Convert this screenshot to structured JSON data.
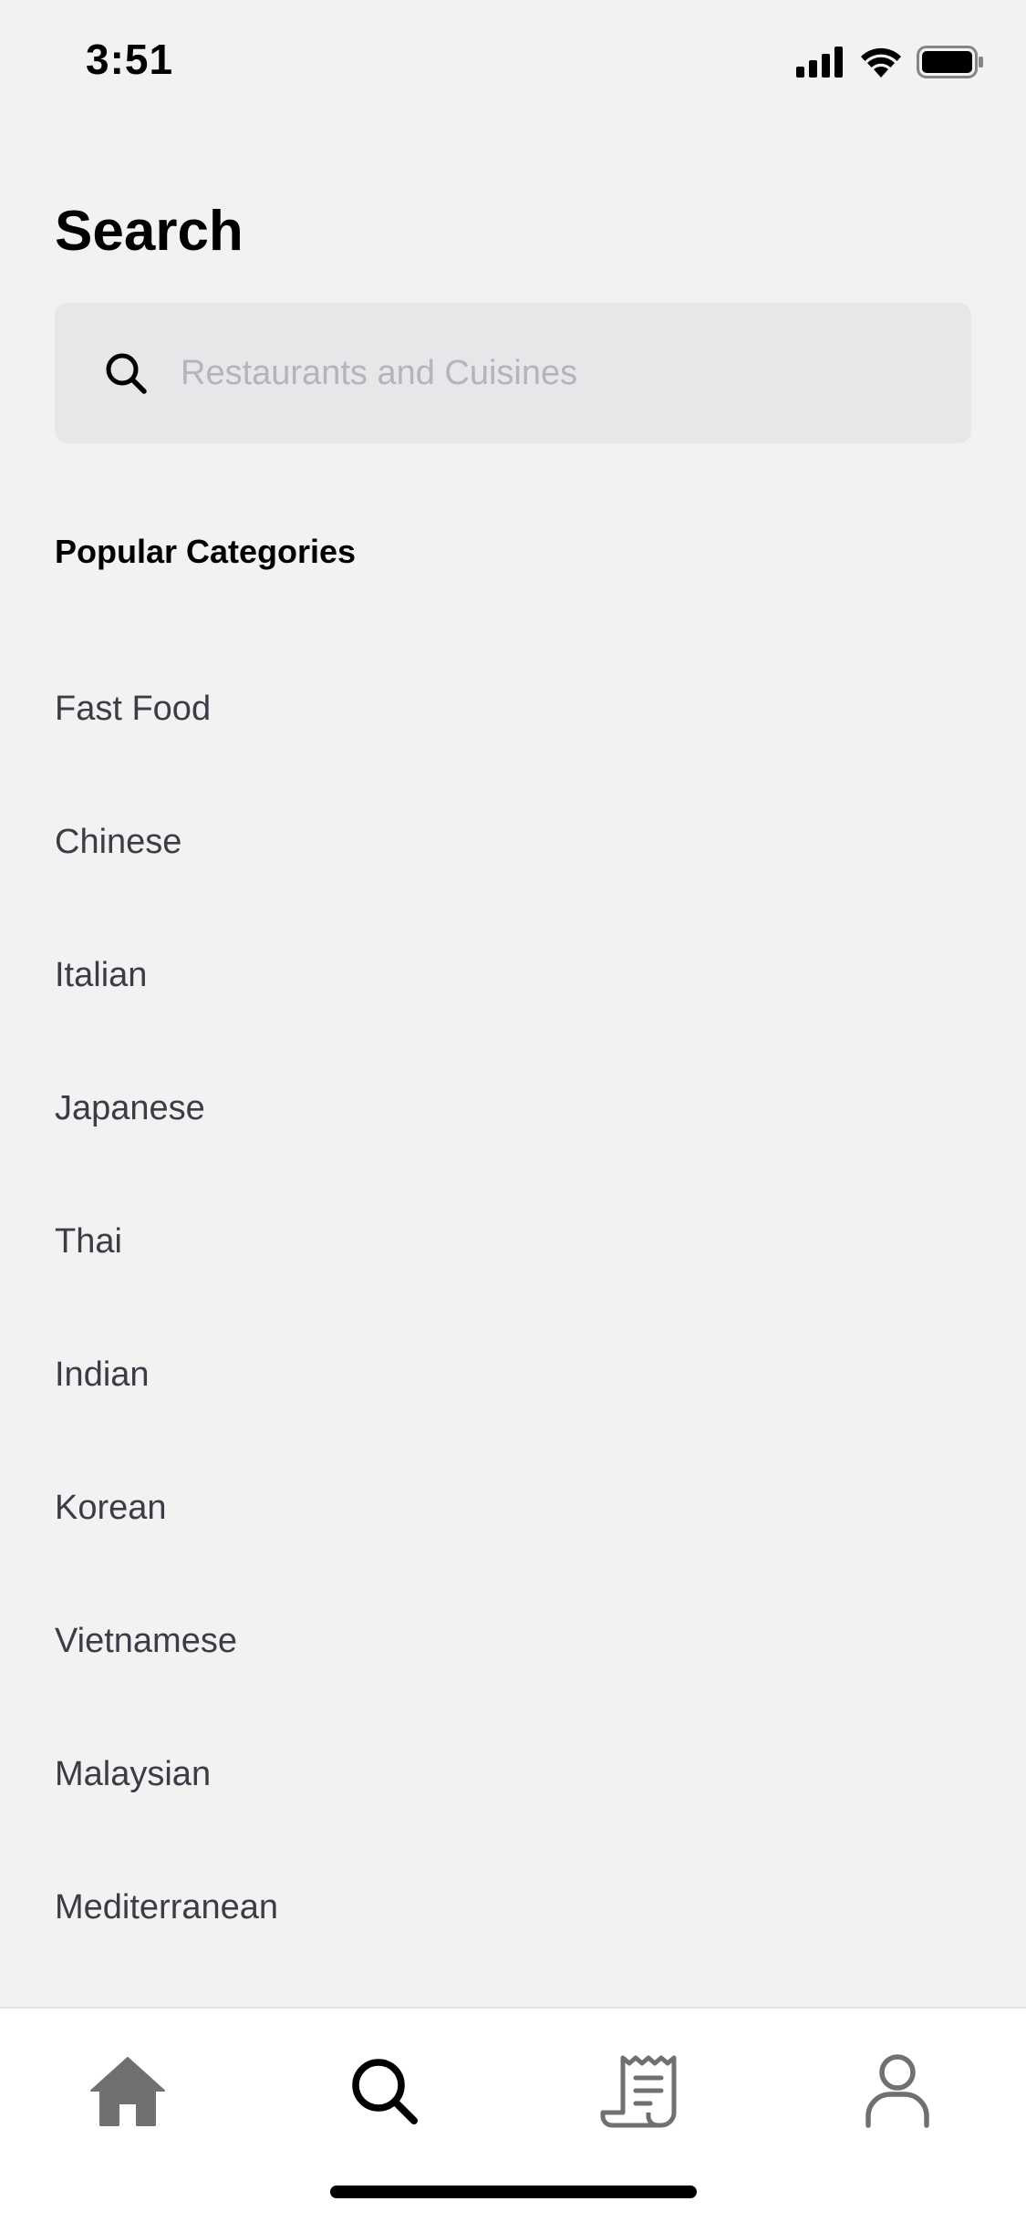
{
  "status_bar": {
    "time": "3:51",
    "icons": [
      "cellular-signal-icon",
      "wifi-icon",
      "battery-icon"
    ]
  },
  "header": {
    "title": "Search"
  },
  "search": {
    "placeholder": "Restaurants and Cuisines",
    "value": "",
    "icon": "search-icon"
  },
  "popular": {
    "title": "Popular Categories",
    "categories": [
      "Fast Food",
      "Chinese",
      "Italian",
      "Japanese",
      "Thai",
      "Indian",
      "Korean",
      "Vietnamese",
      "Malaysian",
      "Mediterranean"
    ]
  },
  "tab_bar": {
    "tabs": [
      {
        "name": "home",
        "icon": "home-icon",
        "active": false
      },
      {
        "name": "search",
        "icon": "search-icon",
        "active": true
      },
      {
        "name": "orders",
        "icon": "receipt-icon",
        "active": false
      },
      {
        "name": "account",
        "icon": "user-icon",
        "active": false
      }
    ]
  },
  "colors": {
    "background": "#f2f2f2",
    "search_field": "#e6e7e9",
    "placeholder": "#b3b5ba",
    "category_text": "#3a3d45",
    "inactive_tab_icon": "#707070",
    "active_tab_icon": "#000000"
  }
}
